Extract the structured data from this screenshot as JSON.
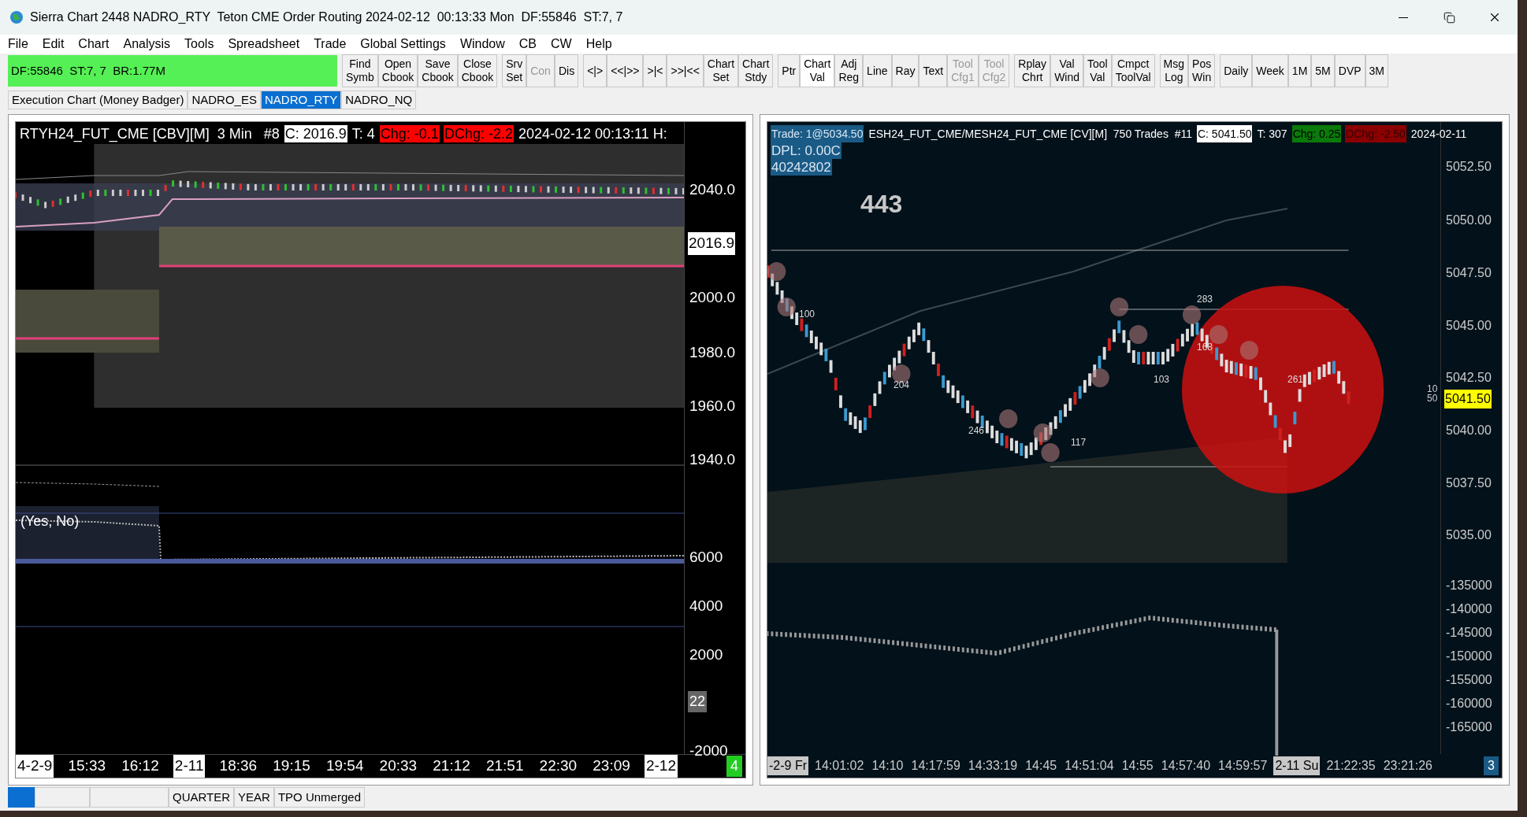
{
  "window": {
    "title": "Sierra Chart 2448 NADRO_RTY  Teton CME Order Routing 2024-02-12  00:13:33 Mon  DF:55846  ST:7, 7"
  },
  "menu": [
    "File",
    "Edit",
    "Chart",
    "Analysis",
    "Tools",
    "Spreadsheet",
    "Trade",
    "Global Settings",
    "Window",
    "CB",
    "CW",
    "Help"
  ],
  "status_box": "DF:55846  ST:7, 7  BR:1.77M",
  "toolbar": [
    [
      {
        "lines": [
          "Find",
          "Symb"
        ],
        "disabled": false,
        "selected": false
      },
      {
        "lines": [
          "Open",
          "Cbook"
        ],
        "disabled": false,
        "selected": false
      },
      {
        "lines": [
          "Save",
          "Cbook"
        ],
        "disabled": false,
        "selected": false
      },
      {
        "lines": [
          "Close",
          "Cbook"
        ],
        "disabled": false,
        "selected": false
      }
    ],
    [
      {
        "lines": [
          "Srv",
          "Set"
        ],
        "disabled": false,
        "selected": false
      },
      {
        "lines": [
          "Con"
        ],
        "disabled": true,
        "selected": false
      },
      {
        "lines": [
          "Dis"
        ],
        "disabled": false,
        "selected": false
      }
    ],
    [
      {
        "lines": [
          "<|>"
        ],
        "disabled": false,
        "selected": false
      },
      {
        "lines": [
          "<<|>>"
        ],
        "disabled": false,
        "selected": false
      },
      {
        "lines": [
          ">|<"
        ],
        "disabled": false,
        "selected": false
      },
      {
        "lines": [
          ">>|<<"
        ],
        "disabled": false,
        "selected": false
      },
      {
        "lines": [
          "Chart",
          "Set"
        ],
        "disabled": false,
        "selected": false
      },
      {
        "lines": [
          "Chart",
          "Stdy"
        ],
        "disabled": false,
        "selected": false
      }
    ],
    [
      {
        "lines": [
          "Ptr"
        ],
        "disabled": false,
        "selected": false
      },
      {
        "lines": [
          "Chart",
          "Val"
        ],
        "disabled": false,
        "selected": true
      },
      {
        "lines": [
          "Adj",
          "Reg"
        ],
        "disabled": false,
        "selected": false
      },
      {
        "lines": [
          "Line"
        ],
        "disabled": false,
        "selected": false
      },
      {
        "lines": [
          "Ray"
        ],
        "disabled": false,
        "selected": false
      },
      {
        "lines": [
          "Text"
        ],
        "disabled": false,
        "selected": false
      },
      {
        "lines": [
          "Tool",
          "Cfg1"
        ],
        "disabled": true,
        "selected": false
      },
      {
        "lines": [
          "Tool",
          "Cfg2"
        ],
        "disabled": true,
        "selected": false
      }
    ],
    [
      {
        "lines": [
          "Rplay",
          "Chrt"
        ],
        "disabled": false,
        "selected": false
      },
      {
        "lines": [
          "Val",
          "Wind"
        ],
        "disabled": false,
        "selected": false
      },
      {
        "lines": [
          "Tool",
          "Val"
        ],
        "disabled": false,
        "selected": false
      },
      {
        "lines": [
          "Cmpct",
          "ToolVal"
        ],
        "disabled": false,
        "selected": false
      }
    ],
    [
      {
        "lines": [
          "Msg",
          "Log"
        ],
        "disabled": false,
        "selected": false
      },
      {
        "lines": [
          "Pos",
          "Win"
        ],
        "disabled": false,
        "selected": false
      }
    ],
    [
      {
        "lines": [
          "Daily"
        ],
        "disabled": false,
        "selected": false
      },
      {
        "lines": [
          "Week"
        ],
        "disabled": false,
        "selected": false
      },
      {
        "lines": [
          "1M"
        ],
        "disabled": false,
        "selected": false
      },
      {
        "lines": [
          "5M"
        ],
        "disabled": false,
        "selected": false
      },
      {
        "lines": [
          "DVP"
        ],
        "disabled": false,
        "selected": false
      },
      {
        "lines": [
          "3M"
        ],
        "disabled": false,
        "selected": false
      }
    ]
  ],
  "chartbook_tabs": [
    {
      "label": "Execution Chart (Money Badger)",
      "selected": false
    },
    {
      "label": "NADRO_ES",
      "selected": false
    },
    {
      "label": "NADRO_RTY",
      "selected": true
    },
    {
      "label": "NADRO_NQ",
      "selected": false
    }
  ],
  "left_chart": {
    "header": [
      {
        "text": "RTYH24_FUT_CME [CBV][M]  3 Min   #8",
        "kind": "plain"
      },
      {
        "text": "C: 2016.9",
        "kind": "white"
      },
      {
        "text": "T: 4",
        "kind": "plain"
      },
      {
        "text": "Chg: -0.1",
        "kind": "red"
      },
      {
        "text": "DChg: -2.2",
        "kind": "red"
      },
      {
        "text": "2024-02-12 00:13:11 H:",
        "kind": "plain"
      }
    ],
    "price_axis": [
      "2040.0",
      "2000.0",
      "1980.0",
      "1960.0",
      "1940.0"
    ],
    "price_badge": "2016.9",
    "subgraph_label": "(Yes, No)",
    "lower_axis": [
      "6000",
      "4000",
      "2000",
      "-2000"
    ],
    "lower_badge": "22",
    "time_axis": [
      {
        "text": "4-2-9",
        "kind": "date"
      },
      {
        "text": "15:33",
        "kind": "time"
      },
      {
        "text": "16:12",
        "kind": "time"
      },
      {
        "text": "2-11",
        "kind": "date"
      },
      {
        "text": "18:36",
        "kind": "time"
      },
      {
        "text": "19:15",
        "kind": "time"
      },
      {
        "text": "19:54",
        "kind": "time"
      },
      {
        "text": "20:33",
        "kind": "time"
      },
      {
        "text": "21:12",
        "kind": "time"
      },
      {
        "text": "21:51",
        "kind": "time"
      },
      {
        "text": "22:30",
        "kind": "time"
      },
      {
        "text": "23:09",
        "kind": "time"
      },
      {
        "text": "2-12",
        "kind": "date"
      }
    ],
    "corner": "4"
  },
  "right_chart": {
    "header": [
      {
        "text": "Trade: 1@5034.50",
        "kind": "blue"
      },
      {
        "text": "ESH24_FUT_CME/MESH24_FUT_CME [CV][M]  750 Trades  #11",
        "kind": "plain"
      },
      {
        "text": "C: 5041.50",
        "kind": "white"
      },
      {
        "text": "T: 307",
        "kind": "plain"
      },
      {
        "text": "Chg: 0.25",
        "kind": "green"
      },
      {
        "text": "DChg: -2.50",
        "kind": "darkred"
      },
      {
        "text": "2024-02-11",
        "kind": "plain"
      }
    ],
    "info_lines": [
      "DPL: 0.00C",
      "40242802"
    ],
    "big_number": "443",
    "price_axis": [
      "5052.50",
      "5050.00",
      "5047.50",
      "5045.00",
      "5042.50",
      "5040.00",
      "5037.50",
      "5035.00"
    ],
    "price_badge": "5041.50",
    "marker_labels": [
      "10",
      "50"
    ],
    "chart_labels": [
      "100",
      "204",
      "246",
      "117",
      "283",
      "168",
      "103",
      "261"
    ],
    "lower_axis": [
      "-135000",
      "-140000",
      "-145000",
      "-150000",
      "-155000",
      "-160000",
      "-165000"
    ],
    "time_axis": [
      {
        "text": "-2-9 Fr",
        "kind": "date"
      },
      {
        "text": "14:01:02",
        "kind": "time"
      },
      {
        "text": "14:10",
        "kind": "time"
      },
      {
        "text": "14:17:59",
        "kind": "time"
      },
      {
        "text": "14:33:19",
        "kind": "time"
      },
      {
        "text": "14:45",
        "kind": "time"
      },
      {
        "text": "14:51:04",
        "kind": "time"
      },
      {
        "text": "14:55",
        "kind": "time"
      },
      {
        "text": "14:57:40",
        "kind": "time"
      },
      {
        "text": "14:59:57",
        "kind": "time"
      },
      {
        "text": "2-11 Su",
        "kind": "date"
      },
      {
        "text": "21:22:35",
        "kind": "time"
      },
      {
        "text": "23:21:26",
        "kind": "time"
      }
    ],
    "corner": "3"
  },
  "bottom_tabs": [
    {
      "label": "QUARTER",
      "selected": false
    },
    {
      "label": "YEAR",
      "selected": false
    },
    {
      "label": "TPO Unmerged",
      "selected": false
    }
  ]
}
